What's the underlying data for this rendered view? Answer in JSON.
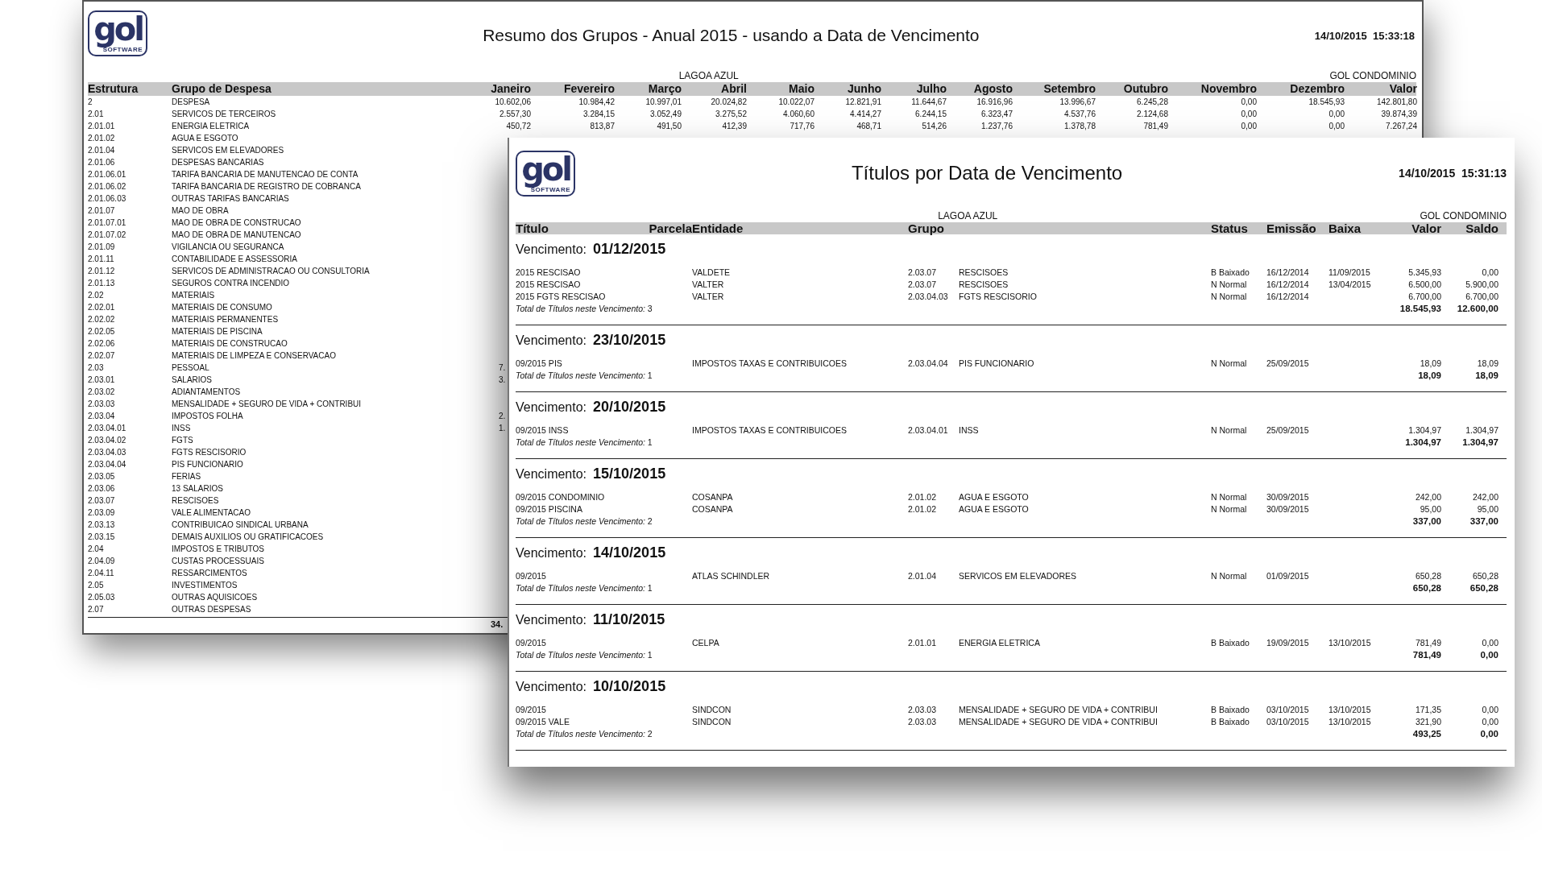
{
  "annual_report": {
    "logo": {
      "wordmark": "gol",
      "tagline": "SOFTWARE"
    },
    "title": "Resumo dos Grupos - Anual 2015 - usando a Data de Vencimento",
    "timestamp": "14/10/2015  15:33:18",
    "subtitle_center": "LAGOA AZUL",
    "subtitle_right": "GOL CONDOMINIO",
    "columns": [
      "Estrutura",
      "Grupo de Despesa",
      "Janeiro",
      "Fevereiro",
      "Março",
      "Abril",
      "Maio",
      "Junho",
      "Julho",
      "Agosto",
      "Setembro",
      "Outubro",
      "Novembro",
      "Dezembro",
      "Valor"
    ],
    "rows": [
      {
        "code": "2",
        "name": "DESPESA",
        "values": [
          "10.602,06",
          "10.984,42",
          "10.997,01",
          "20.024,82",
          "10.022,07",
          "12.821,91",
          "11.644,67",
          "16.916,96",
          "13.996,67",
          "6.245,28",
          "0,00",
          "18.545,93",
          "142.801,80"
        ]
      },
      {
        "code": "2.01",
        "name": "SERVICOS DE TERCEIROS",
        "values": [
          "2.557,30",
          "3.284,15",
          "3.052,49",
          "3.275,52",
          "4.060,60",
          "4.414,27",
          "6.244,15",
          "6.323,47",
          "4.537,76",
          "2.124,68",
          "0,00",
          "0,00",
          "39.874,39"
        ]
      },
      {
        "code": "2.01.01",
        "name": "ENERGIA ELETRICA",
        "values": [
          "450,72",
          "813,87",
          "491,50",
          "412,39",
          "717,76",
          "468,71",
          "514,26",
          "1.237,76",
          "1.378,78",
          "781,49",
          "0,00",
          "0,00",
          "7.267,24"
        ]
      },
      {
        "code": "2.01.02",
        "name": "AGUA E ESGOTO"
      },
      {
        "code": "2.01.04",
        "name": "SERVICOS EM ELEVADORES"
      },
      {
        "code": "2.01.06",
        "name": "DESPESAS BANCARIAS"
      },
      {
        "code": "2.01.06.01",
        "name": "TARIFA BANCARIA DE MANUTENCAO DE CONTA"
      },
      {
        "code": "2.01.06.02",
        "name": "TARIFA BANCARIA DE REGISTRO DE COBRANCA"
      },
      {
        "code": "2.01.06.03",
        "name": "OUTRAS TARIFAS BANCARIAS"
      },
      {
        "code": "2.01.07",
        "name": "MAO DE OBRA"
      },
      {
        "code": "2.01.07.01",
        "name": "MAO DE OBRA DE CONSTRUCAO"
      },
      {
        "code": "2.01.07.02",
        "name": "MAO DE OBRA DE MANUTENCAO"
      },
      {
        "code": "2.01.09",
        "name": "VIGILANCIA OU SEGURANCA"
      },
      {
        "code": "2.01.11",
        "name": "CONTABILIDADE E ASSESSORIA"
      },
      {
        "code": "2.01.12",
        "name": "SERVICOS DE ADMINISTRACAO OU CONSULTORIA"
      },
      {
        "code": "2.01.13",
        "name": "SEGUROS CONTRA INCENDIO"
      },
      {
        "code": "2.02",
        "name": "MATERIAIS"
      },
      {
        "code": "2.02.01",
        "name": "MATERIAIS DE CONSUMO"
      },
      {
        "code": "2.02.02",
        "name": "MATERIAIS PERMANENTES"
      },
      {
        "code": "2.02.05",
        "name": "MATERIAIS DE PISCINA"
      },
      {
        "code": "2.02.06",
        "name": "MATERIAIS DE CONSTRUCAO"
      },
      {
        "code": "2.02.07",
        "name": "MATERIAIS DE LIMPEZA E CONSERVACAO"
      },
      {
        "code": "2.03",
        "name": "PESSOAL",
        "cut_value": "7."
      },
      {
        "code": "2.03.01",
        "name": "SALARIOS",
        "cut_value": "3."
      },
      {
        "code": "2.03.02",
        "name": "ADIANTAMENTOS"
      },
      {
        "code": "2.03.03",
        "name": "MENSALIDADE + SEGURO DE VIDA + CONTRIBUI"
      },
      {
        "code": "2.03.04",
        "name": "IMPOSTOS FOLHA",
        "cut_value": "2."
      },
      {
        "code": "2.03.04.01",
        "name": "INSS",
        "cut_value": "1."
      },
      {
        "code": "2.03.04.02",
        "name": "FGTS"
      },
      {
        "code": "2.03.04.03",
        "name": "FGTS RESCISORIO"
      },
      {
        "code": "2.03.04.04",
        "name": "PIS FUNCIONARIO"
      },
      {
        "code": "2.03.05",
        "name": "FERIAS"
      },
      {
        "code": "2.03.06",
        "name": "13 SALARIOS"
      },
      {
        "code": "2.03.07",
        "name": "RESCISOES"
      },
      {
        "code": "2.03.09",
        "name": "VALE ALIMENTACAO"
      },
      {
        "code": "2.03.13",
        "name": "CONTRIBUICAO SINDICAL URBANA"
      },
      {
        "code": "2.03.15",
        "name": "DEMAIS AUXILIOS OU GRATIFICACOES"
      },
      {
        "code": "2.04",
        "name": "IMPOSTOS E TRIBUTOS"
      },
      {
        "code": "2.04.09",
        "name": "CUSTAS PROCESSUAIS"
      },
      {
        "code": "2.04.11",
        "name": "RESSARCIMENTOS"
      },
      {
        "code": "2.05",
        "name": "INVESTIMENTOS"
      },
      {
        "code": "2.05.03",
        "name": "OUTRAS AQUISICOES"
      },
      {
        "code": "2.07",
        "name": "OUTRAS DESPESAS"
      }
    ],
    "total_cut": "34."
  },
  "due_report": {
    "logo": {
      "wordmark": "gol",
      "tagline": "SOFTWARE"
    },
    "title": "Títulos por Data de Vencimento",
    "timestamp": "14/10/2015  15:31:13",
    "subtitle_center": "LAGOA AZUL",
    "subtitle_right": "GOL CONDOMINIO",
    "columns": [
      "Título",
      "Parcela",
      "Entidade",
      "Grupo",
      "Status",
      "Emissão",
      "Baixa",
      "Valor",
      "Saldo"
    ],
    "groups": [
      {
        "label": "Vencimento:",
        "date": "01/12/2015",
        "rows": [
          {
            "titulo": "2015 RESCISAO",
            "entidade": "VALDETE",
            "grupo_code": "2.03.07",
            "grupo_name": "RESCISOES",
            "status": "B Baixado",
            "emissao": "16/12/2014",
            "baixa": "11/09/2015",
            "valor": "5.345,93",
            "saldo": "0,00"
          },
          {
            "titulo": "2015 RESCISAO",
            "entidade": "VALTER",
            "grupo_code": "2.03.07",
            "grupo_name": "RESCISOES",
            "status": "N Normal",
            "emissao": "16/12/2014",
            "baixa": "13/04/2015",
            "valor": "6.500,00",
            "saldo": "5.900,00"
          },
          {
            "titulo": "2015 FGTS RESCISAO",
            "entidade": "VALTER",
            "grupo_code": "2.03.04.03",
            "grupo_name": "FGTS RESCISORIO",
            "status": "N Normal",
            "emissao": "16/12/2014",
            "valor": "6.700,00",
            "saldo": "6.700,00"
          }
        ],
        "total_label": "*Total de Títulos neste Vencimento:* 3",
        "total_valor": "18.545,93",
        "total_saldo": "12.600,00"
      },
      {
        "label": "Vencimento:",
        "date": "23/10/2015",
        "rows": [
          {
            "titulo": "09/2015 PIS",
            "entidade": "IMPOSTOS TAXAS E CONTRIBUICOES",
            "grupo_code": "2.03.04.04",
            "grupo_name": "PIS FUNCIONARIO",
            "status": "N Normal",
            "emissao": "25/09/2015",
            "valor": "18,09",
            "saldo": "18,09"
          }
        ],
        "total_label": "*Total de Títulos neste Vencimento:* 1",
        "total_valor": "18,09",
        "total_saldo": "18,09"
      },
      {
        "label": "Vencimento:",
        "date": "20/10/2015",
        "rows": [
          {
            "titulo": "09/2015 INSS",
            "entidade": "IMPOSTOS TAXAS E CONTRIBUICOES",
            "grupo_code": "2.03.04.01",
            "grupo_name": "INSS",
            "status": "N Normal",
            "emissao": "25/09/2015",
            "valor": "1.304,97",
            "saldo": "1.304,97"
          }
        ],
        "total_label": "*Total de Títulos neste Vencimento:* 1",
        "total_valor": "1.304,97",
        "total_saldo": "1.304,97"
      },
      {
        "label": "Vencimento:",
        "date": "15/10/2015",
        "rows": [
          {
            "titulo": "09/2015 CONDOMINIO",
            "entidade": "COSANPA",
            "grupo_code": "2.01.02",
            "grupo_name": "AGUA E ESGOTO",
            "status": "N Normal",
            "emissao": "30/09/2015",
            "valor": "242,00",
            "saldo": "242,00"
          },
          {
            "titulo": "09/2015 PISCINA",
            "entidade": "COSANPA",
            "grupo_code": "2.01.02",
            "grupo_name": "AGUA E ESGOTO",
            "status": "N Normal",
            "emissao": "30/09/2015",
            "valor": "95,00",
            "saldo": "95,00"
          }
        ],
        "total_label": "*Total de Títulos neste Vencimento:* 2",
        "total_valor": "337,00",
        "total_saldo": "337,00"
      },
      {
        "label": "Vencimento:",
        "date": "14/10/2015",
        "rows": [
          {
            "titulo": "09/2015",
            "entidade": "ATLAS SCHINDLER",
            "grupo_code": "2.01.04",
            "grupo_name": "SERVICOS EM ELEVADORES",
            "status": "N Normal",
            "emissao": "01/09/2015",
            "valor": "650,28",
            "saldo": "650,28"
          }
        ],
        "total_label": "*Total de Títulos neste Vencimento:* 1",
        "total_valor": "650,28",
        "total_saldo": "650,28"
      },
      {
        "label": "Vencimento:",
        "date": "11/10/2015",
        "rows": [
          {
            "titulo": "09/2015",
            "entidade": "CELPA",
            "grupo_code": "2.01.01",
            "grupo_name": "ENERGIA ELETRICA",
            "status": "B Baixado",
            "emissao": "19/09/2015",
            "baixa": "13/10/2015",
            "valor": "781,49",
            "saldo": "0,00"
          }
        ],
        "total_label": "*Total de Títulos neste Vencimento:* 1",
        "total_valor": "781,49",
        "total_saldo": "0,00"
      },
      {
        "label": "Vencimento:",
        "date": "10/10/2015",
        "rows": [
          {
            "titulo": "09/2015",
            "entidade": "SINDCON",
            "grupo_code": "2.03.03",
            "grupo_name": "MENSALIDADE + SEGURO DE VIDA + CONTRIBUI",
            "status": "B Baixado",
            "emissao": "03/10/2015",
            "baixa": "13/10/2015",
            "valor": "171,35",
            "saldo": "0,00"
          },
          {
            "titulo": "09/2015 VALE",
            "entidade": "SINDCON",
            "grupo_code": "2.03.03",
            "grupo_name": "MENSALIDADE + SEGURO DE VIDA + CONTRIBUI",
            "status": "B Baixado",
            "emissao": "03/10/2015",
            "baixa": "13/10/2015",
            "valor": "321,90",
            "saldo": "0,00"
          }
        ],
        "total_label": "*Total de Títulos neste Vencimento:* 2",
        "total_valor": "493,25",
        "total_saldo": "0,00"
      }
    ]
  }
}
